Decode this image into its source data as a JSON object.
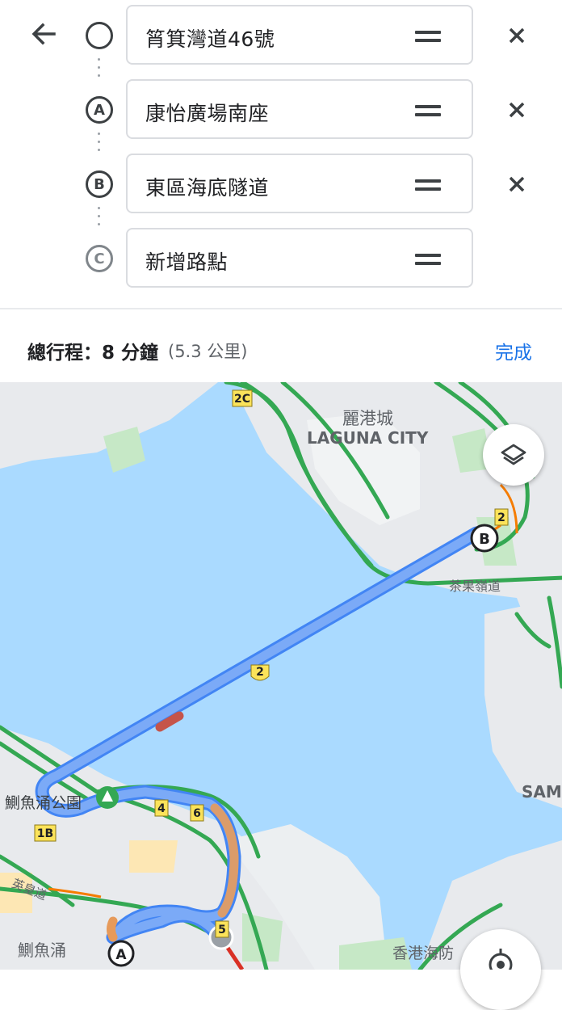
{
  "stops": [
    {
      "marker": "",
      "value": "筲箕灣道46號",
      "type": "origin"
    },
    {
      "marker": "A",
      "value": "康怡廣場南座",
      "type": "waypoint"
    },
    {
      "marker": "B",
      "value": "東區海底隧道",
      "type": "waypoint"
    },
    {
      "marker": "C",
      "value": "新增路點",
      "type": "add"
    }
  ],
  "summary": {
    "total": "總行程：8 分鐘",
    "distance": "(5.3 公里)",
    "done": "完成"
  },
  "map": {
    "labels": {
      "laguna_zh": "麗港城",
      "laguna_en": "LAGUNA CITY",
      "cha_kwo_ling": "茶果嶺道",
      "park": "鰂魚涌公園",
      "quarry_bay": "鰂魚涌",
      "kings_road": "英皇道",
      "museum": "香港海防",
      "sam": "SAM"
    },
    "shields": {
      "s2c": "2C",
      "s2a": "2",
      "s2b": "2",
      "s1b": "1B",
      "s4": "4",
      "s6": "6",
      "s5": "5"
    },
    "markers": {
      "a": "A",
      "b": "B"
    }
  },
  "colors": {
    "water": "#aadaff",
    "route": "#7baaf7",
    "route_edge": "#4285f4",
    "traffic_green": "#34a853",
    "traffic_orange": "#f4b400",
    "link": "#1a73e8"
  }
}
